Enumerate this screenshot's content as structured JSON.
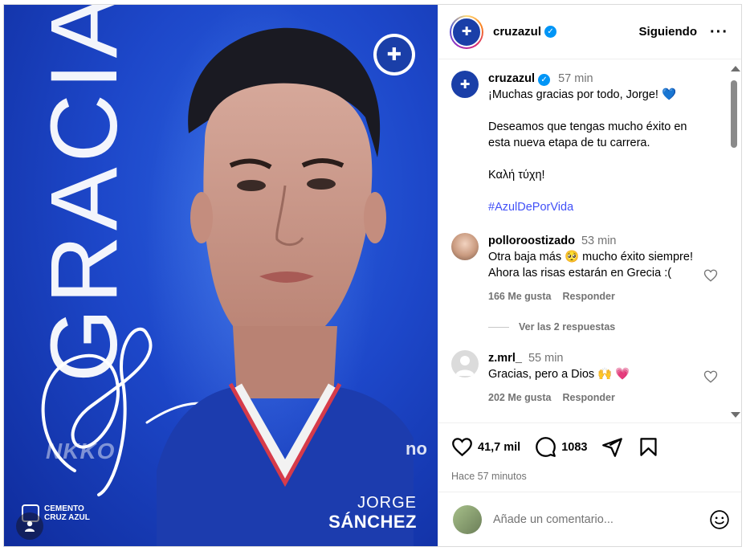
{
  "post_image": {
    "headline": "GRACIAS",
    "player_first_name": "JORGE",
    "player_last_name": "SÁNCHEZ",
    "sponsor_text": [
      "CEMENTO",
      "CRUZ AZUL"
    ],
    "background_color": "#1d47c9"
  },
  "header": {
    "username": "cruzazul",
    "follow_status": "Siguiendo",
    "more_icon": "more-horizontal-icon"
  },
  "caption": {
    "username": "cruzazul",
    "time": "57 min",
    "line1": "¡Muchas gracias por todo, Jorge! 💙",
    "line2": "Deseamos que tengas mucho éxito en esta nueva etapa de tu carrera.",
    "line3": "Καλή τύχη!",
    "hashtag": "#AzulDePorVida"
  },
  "comments": [
    {
      "username": "polloroostizado",
      "time": "53 min",
      "text": "Otra baja más 🥺 mucho éxito siempre! Ahora las risas estarán en Grecia :(",
      "likes": "166 Me gusta",
      "reply_label": "Responder",
      "view_replies": "Ver las 2 respuestas"
    },
    {
      "username": "z.mrl_",
      "time": "55 min",
      "text": "Gracias, pero a Dios 🙌 💗",
      "likes": "202 Me gusta",
      "reply_label": "Responder"
    }
  ],
  "actions": {
    "likes_count": "41,7 mil",
    "comments_count": "1083",
    "posted": "Hace 57 minutos"
  },
  "composer": {
    "placeholder": "Añade un comentario..."
  },
  "colors": {
    "verified": "#0095f6",
    "hashtag": "#4150f7",
    "muted": "#737373"
  }
}
